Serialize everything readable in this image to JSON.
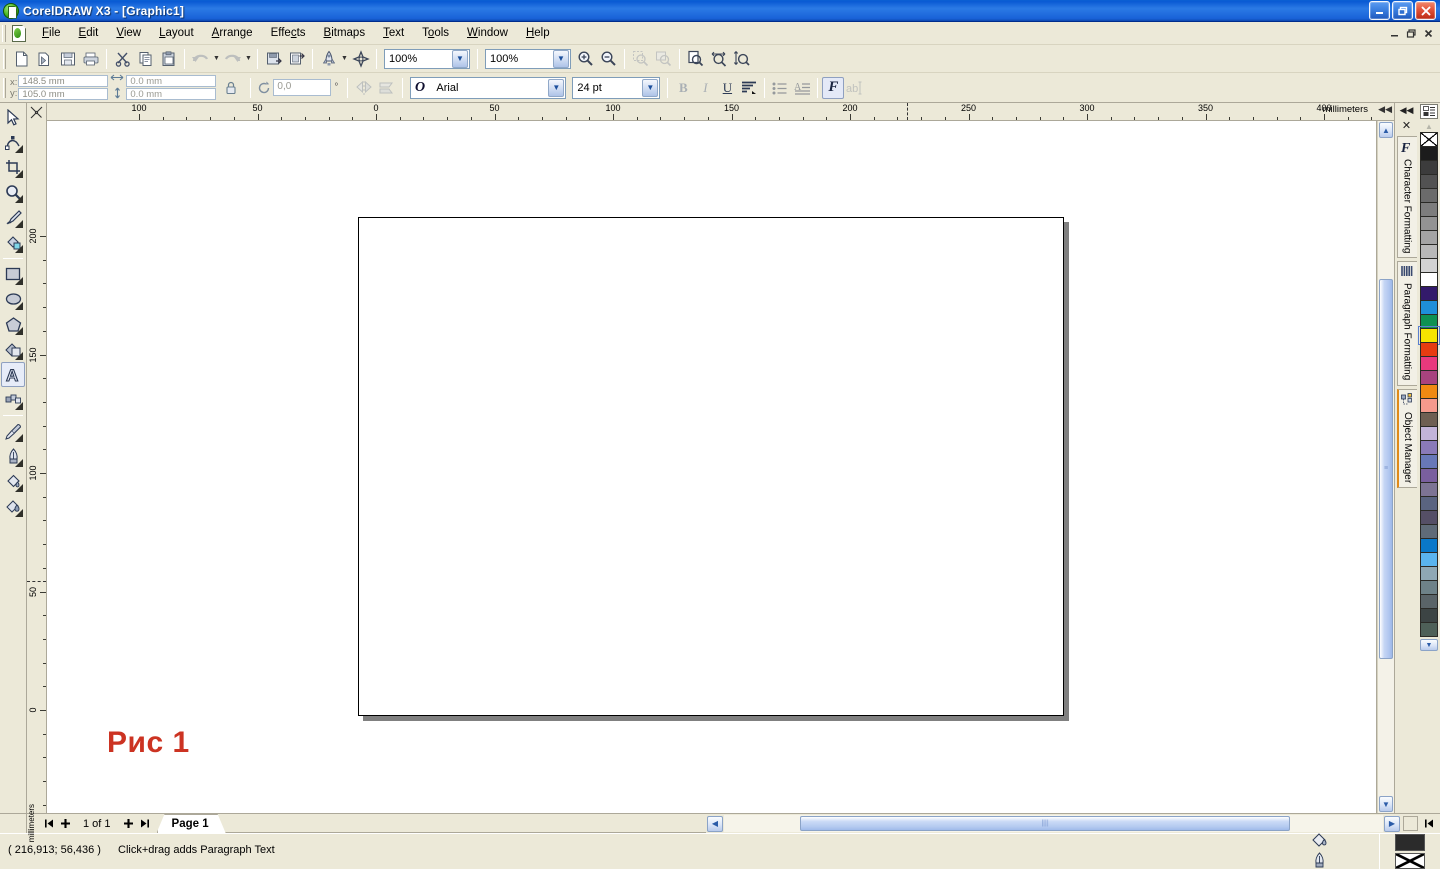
{
  "window": {
    "title": "CorelDRAW X3 - [Graphic1]",
    "app_icon": "coreldraw-balloon-icon",
    "minimize_label": "Minimize",
    "maximize_label": "Maximize",
    "close_label": "Close",
    "mdi_minimize_label": "Minimize Document",
    "mdi_restore_label": "Restore Document",
    "mdi_close_label": "Close Document",
    "titlebar_color": "#1962d8"
  },
  "menu": {
    "document_icon": "document-icon",
    "items": [
      {
        "label": "File",
        "accel": "F"
      },
      {
        "label": "Edit",
        "accel": "E"
      },
      {
        "label": "View",
        "accel": "V"
      },
      {
        "label": "Layout",
        "accel": "L"
      },
      {
        "label": "Arrange",
        "accel": "A"
      },
      {
        "label": "Effects",
        "accel": "c"
      },
      {
        "label": "Bitmaps",
        "accel": "B"
      },
      {
        "label": "Text",
        "accel": "T"
      },
      {
        "label": "Tools",
        "accel": "o"
      },
      {
        "label": "Window",
        "accel": "W"
      },
      {
        "label": "Help",
        "accel": "H"
      }
    ]
  },
  "standard_toolbar": {
    "buttons": [
      {
        "name": "new-button",
        "icon": "new-document-icon",
        "enabled": true
      },
      {
        "name": "open-button",
        "icon": "open-folder-icon",
        "enabled": true
      },
      {
        "name": "save-button",
        "icon": "save-disk-icon",
        "enabled": true
      },
      {
        "name": "print-button",
        "icon": "printer-icon",
        "enabled": true
      },
      {
        "name": "cut-button",
        "icon": "scissors-icon",
        "enabled": true
      },
      {
        "name": "copy-button",
        "icon": "copy-icon",
        "enabled": true
      },
      {
        "name": "paste-button",
        "icon": "clipboard-paste-icon",
        "enabled": true
      },
      {
        "name": "undo-button",
        "icon": "undo-arrow-icon",
        "enabled": false
      },
      {
        "name": "redo-button",
        "icon": "redo-arrow-icon",
        "enabled": false
      },
      {
        "name": "import-button",
        "icon": "import-icon",
        "enabled": true
      },
      {
        "name": "export-button",
        "icon": "export-icon",
        "enabled": true
      },
      {
        "name": "application-launcher",
        "icon": "rocket-icon",
        "enabled": true
      },
      {
        "name": "corel-online-button",
        "icon": "corel-online-icon",
        "enabled": true
      }
    ],
    "zoom_level": "100%",
    "zoom_level_2": "100%",
    "zoom_buttons": [
      {
        "name": "zoom-in-button",
        "icon": "zoom-in-icon",
        "enabled": true
      },
      {
        "name": "zoom-out-button",
        "icon": "zoom-out-icon",
        "enabled": true
      },
      {
        "name": "zoom-to-selection",
        "icon": "zoom-selection-icon",
        "enabled": false
      },
      {
        "name": "zoom-to-all-objects",
        "icon": "zoom-objects-icon",
        "enabled": false
      },
      {
        "name": "zoom-to-page",
        "icon": "zoom-page-icon",
        "enabled": true
      },
      {
        "name": "zoom-to-page-width",
        "icon": "zoom-width-icon",
        "enabled": true
      },
      {
        "name": "zoom-to-page-height",
        "icon": "zoom-height-icon",
        "enabled": true
      }
    ]
  },
  "property_bar": {
    "x_label": "x:",
    "y_label": "y:",
    "x_value": "148.5 mm",
    "y_value": "105.0 mm",
    "width_value": "0.0 mm",
    "height_value": "0.0 mm",
    "width_icon": "width-arrows-icon",
    "height_icon": "height-arrows-icon",
    "lock_icon": "lock-ratio-icon",
    "rotation_icon": "rotation-icon",
    "rotation_value": "0,0",
    "degree_symbol": "°",
    "mirror_h_icon": "mirror-horizontal-icon",
    "mirror_v_icon": "mirror-vertical-icon",
    "font_icon": "truetype-font-icon",
    "font_family": "Arial",
    "font_size": "24 pt",
    "bold_label": "B",
    "italic_label": "I",
    "underline_label": "U",
    "align_icon": "text-align-icon",
    "bullets_icon": "bullet-list-icon",
    "dropcap_icon": "drop-cap-icon",
    "char_format_label": "F",
    "edit_text_icon": "edit-text-icon"
  },
  "toolbox": {
    "tools": [
      {
        "name": "pick-tool",
        "icon": "arrow-cursor-icon",
        "selected": false,
        "flyout": false
      },
      {
        "name": "shape-tool",
        "icon": "shape-node-icon",
        "selected": false,
        "flyout": true
      },
      {
        "name": "crop-tool",
        "icon": "crop-icon",
        "selected": false,
        "flyout": true
      },
      {
        "name": "zoom-tool",
        "icon": "magnifier-icon",
        "selected": false,
        "flyout": true
      },
      {
        "name": "freehand-tool",
        "icon": "pencil-icon",
        "selected": false,
        "flyout": true
      },
      {
        "name": "smart-fill-tool",
        "icon": "smart-fill-icon",
        "selected": false,
        "flyout": true
      },
      {
        "name": "rectangle-tool",
        "icon": "rectangle-icon",
        "selected": false,
        "flyout": true
      },
      {
        "name": "ellipse-tool",
        "icon": "ellipse-icon",
        "selected": false,
        "flyout": true
      },
      {
        "name": "polygon-tool",
        "icon": "polygon-icon",
        "selected": false,
        "flyout": true
      },
      {
        "name": "basic-shapes-tool",
        "icon": "basic-shapes-icon",
        "selected": false,
        "flyout": true
      },
      {
        "name": "text-tool",
        "icon": "text-a-icon",
        "selected": true,
        "flyout": false
      },
      {
        "name": "blend-tool",
        "icon": "interactive-blend-icon",
        "selected": false,
        "flyout": true
      },
      {
        "name": "eyedropper-tool",
        "icon": "eyedropper-icon",
        "selected": false,
        "flyout": true
      },
      {
        "name": "outline-tool",
        "icon": "outline-pen-icon",
        "selected": false,
        "flyout": true
      },
      {
        "name": "fill-tool",
        "icon": "fill-bucket-icon",
        "selected": false,
        "flyout": true
      },
      {
        "name": "interactive-fill",
        "icon": "interactive-fill-icon",
        "selected": false,
        "flyout": true
      }
    ]
  },
  "rulers": {
    "unit_label": "millimeters",
    "vertical_unit_label": "millimeters",
    "collapse_icon": "collapse-left-icon",
    "origin_icon": "ruler-origin-icon",
    "horizontal_labels": [
      "100",
      "50",
      "0",
      "50",
      "100",
      "150",
      "200",
      "250",
      "300",
      "350",
      "400"
    ],
    "vertical_labels": [
      "200",
      "150",
      "100",
      "50",
      "0"
    ]
  },
  "canvas": {
    "page_label": "drawing-page",
    "caption_text": "Рис 1",
    "caption_color": "#cc3322"
  },
  "dockers": {
    "collapse_icon": "collapse-right-icon",
    "close_icon": "close-docker-icon",
    "tabs": [
      {
        "name": "docker-character-formatting",
        "label": "Character Formatting",
        "icon": "character-f-icon",
        "active": false
      },
      {
        "name": "docker-paragraph-formatting",
        "label": "Paragraph Formatting",
        "icon": "paragraph-lines-icon",
        "active": false
      },
      {
        "name": "docker-object-manager",
        "label": "Object Manager",
        "icon": "object-manager-icon",
        "active": true
      }
    ]
  },
  "palette": {
    "top_icon": "palette-options-icon",
    "scroll_up_icon": "palette-scroll-up-icon",
    "scroll_down_icon": "palette-scroll-down-icon",
    "first_icon": "palette-first-icon",
    "selected_index": 14,
    "colors": [
      "none",
      "#1c1c1c",
      "#3c3c3c",
      "#525252",
      "#6b6b6b",
      "#7d7d7d",
      "#939393",
      "#a4a4a4",
      "#b8b8b8",
      "#d2d2d2",
      "#ffffff",
      "#331a6b",
      "#1e8fd9",
      "#0f9152",
      "#f5e400",
      "#e63c10",
      "#e8397c",
      "#a8437e",
      "#f08a12",
      "#f59a8c",
      "#6e5f52",
      "#c2b4d8",
      "#8a7ab8",
      "#6878b8",
      "#7a5f9e",
      "#7d7494",
      "#5a6480",
      "#554f66",
      "#5f6b78",
      "#0a78c8",
      "#5ab4ee",
      "#8fa8b4",
      "#6e8288",
      "#5a6468",
      "#3c4444",
      "#4e6058"
    ]
  },
  "page_navigator": {
    "first_page_icon": "first-page-icon",
    "add_page_before_icon": "add-page-icon",
    "page_count_label": "1 of 1",
    "add_page_after_icon": "add-page-icon",
    "last_page_icon": "last-page-icon",
    "tab_label": "Page 1"
  },
  "horizontal_scrollbar": {
    "left_icon": "scroll-left-icon",
    "right_icon": "scroll-right-icon",
    "grip_icon": "scrollbar-grip-icon"
  },
  "vertical_scrollbar": {
    "up_icon": "scroll-up-icon",
    "down_icon": "scroll-down-icon",
    "grip_icon": "scrollbar-grip-icon"
  },
  "status_bar": {
    "coordinates": "( 216,913; 56,436 )",
    "hint": "Click+drag adds Paragraph Text",
    "fill_icon": "fill-bucket-icon",
    "outline_icon": "outline-pen-icon",
    "fill_color": "#2b2b2b",
    "outline_swatch": "none"
  }
}
